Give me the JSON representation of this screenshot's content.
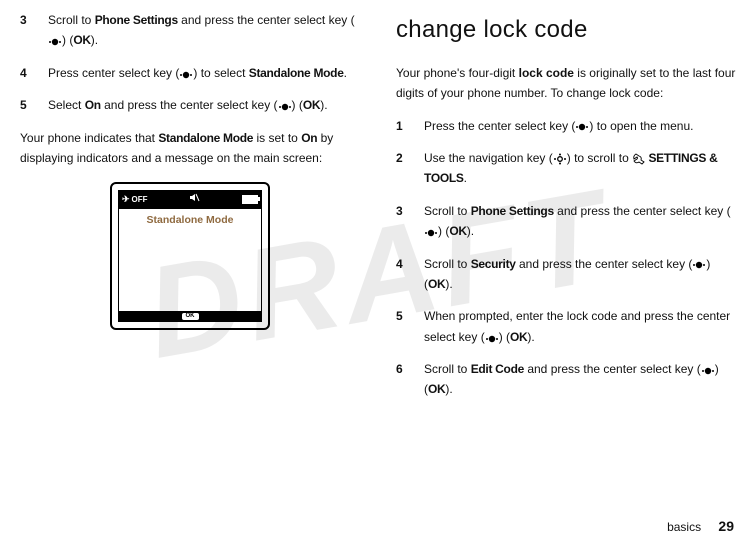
{
  "left": {
    "step3": {
      "num": "3",
      "text_a": "Scroll to ",
      "phone_settings": "Phone Settings",
      "text_b": " and press the center select key (",
      "text_c": ") (",
      "ok": "OK",
      "text_d": ")."
    },
    "step4": {
      "num": "4",
      "text_a": "Press center select key (",
      "text_b": ") to select ",
      "standalone": "Standalone Mode",
      "text_c": "."
    },
    "step5": {
      "num": "5",
      "text_a": "Select ",
      "on": "On",
      "text_b": " and press the center select key (",
      "text_c": ") (",
      "ok": "OK",
      "text_d": ")."
    },
    "para_a": "Your phone indicates that ",
    "para_standalone": "Standalone Mode",
    "para_b": " is set to ",
    "para_on": "On",
    "para_c": " by displaying indicators and a message on the main screen:",
    "phone": {
      "off": "OFF",
      "title": "Standalone Mode",
      "soft_ok": "OK"
    }
  },
  "right": {
    "heading": "change lock code",
    "intro_a": "Your phone's four-digit ",
    "intro_bold": "lock code",
    "intro_b": " is originally set to the last four digits of your phone number. To change lock code:",
    "step1": {
      "num": "1",
      "text_a": "Press the center select key (",
      "text_b": ") to open the menu."
    },
    "step2": {
      "num": "2",
      "text_a": "Use the navigation key (",
      "text_b": ") to scroll to ",
      "settings": "SETTINGS & TOOLS",
      "text_c": "."
    },
    "step3": {
      "num": "3",
      "text_a": "Scroll to ",
      "phone_settings": "Phone Settings",
      "text_b": " and press the center select key (",
      "text_c": ") (",
      "ok": "OK",
      "text_d": ")."
    },
    "step4": {
      "num": "4",
      "text_a": "Scroll to ",
      "security": "Security",
      "text_b": " and press the center select key (",
      "text_c": ") (",
      "ok": "OK",
      "text_d": ")."
    },
    "step5": {
      "num": "5",
      "text_a": "When prompted, enter the lock code and press the center select key (",
      "text_b": ") (",
      "ok": "OK",
      "text_c": ")."
    },
    "step6": {
      "num": "6",
      "text_a": "Scroll to ",
      "edit_code": "Edit Code",
      "text_b": " and press the center select key (",
      "text_c": ") (",
      "ok": "OK",
      "text_d": ")."
    }
  },
  "footer": {
    "section": "basics",
    "page": "29"
  }
}
